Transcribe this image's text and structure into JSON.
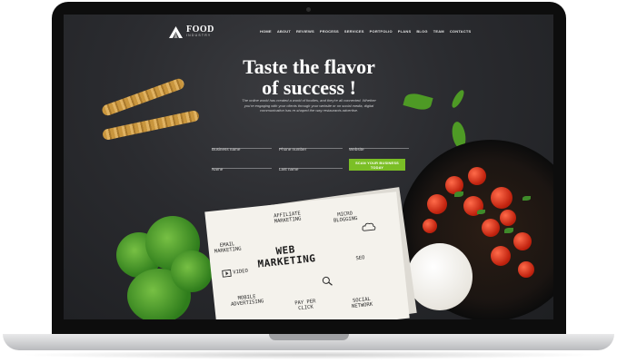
{
  "brand": {
    "name": "FOOD",
    "tagline": "INDUSTRY"
  },
  "nav": {
    "items": [
      "HOME",
      "ABOUT",
      "REVIEWS",
      "PROCESS",
      "SERVICES",
      "PORTFOLIO",
      "PLANS",
      "BLOG",
      "TEAM",
      "CONTACTS"
    ]
  },
  "hero": {
    "headline_line1": "Taste the flavor",
    "headline_line2": "of success !",
    "paragraph": "The online world has created a world of foodies, and they're all connected. Whether you're engaging with your clients through your website or on social media, digital communication has re-shaped the way restaurants advertise."
  },
  "form": {
    "business_name": {
      "placeholder": "Business name",
      "value": ""
    },
    "phone_number": {
      "placeholder": "Phone number",
      "value": ""
    },
    "website": {
      "placeholder": "Website",
      "value": ""
    },
    "name": {
      "placeholder": "Name",
      "value": ""
    },
    "last_name": {
      "placeholder": "Last name",
      "value": ""
    },
    "submit_label": "SCAN YOUR BUSINESS TODAY"
  },
  "sketch": {
    "title_line1": "WEB",
    "title_line2": "MARKETING",
    "affiliate": "AFFILIATE\nMARKETING",
    "micro": "MICRO\nBLOGGING",
    "email": "EMAIL\nMARKETING",
    "video": "VIDEO",
    "seo": "SEO",
    "mobile": "MOBILE\nADVERTISING",
    "ppc": "PAY PER\nCLICK",
    "social": "SOCIAL\nNETWORK"
  },
  "colors": {
    "accent": "#7bbf26",
    "screen_bg": "#2a2b2f",
    "text": "#ffffff"
  }
}
